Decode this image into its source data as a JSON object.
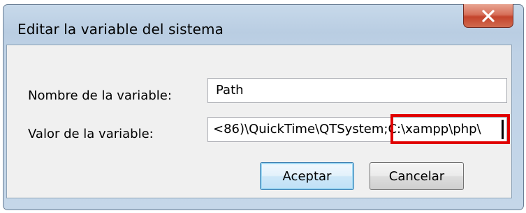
{
  "window": {
    "title": "Editar la variable del sistema",
    "close_icon": "close-x-icon"
  },
  "form": {
    "name_label": "Nombre de la variable:",
    "name_value": "Path",
    "value_label": "Valor de la variable:",
    "value_visible_before_highlight": "<86)\\QuickTime\\QTSystem",
    "value_visible_highlighted": ";C:\\xampp\\php\\"
  },
  "buttons": {
    "ok": "Aceptar",
    "cancel": "Cancelar"
  },
  "colors": {
    "highlight_box": "#e00000",
    "close_button": "#c4442c"
  }
}
